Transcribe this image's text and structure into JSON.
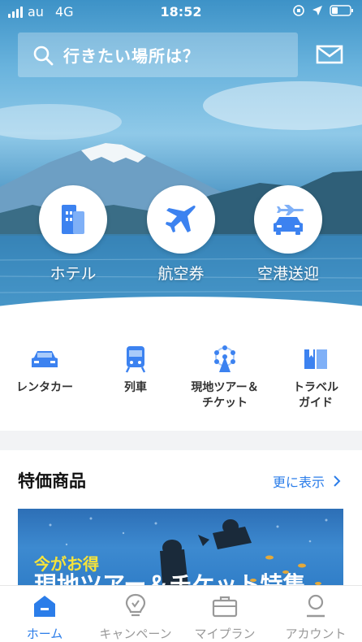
{
  "status_bar": {
    "carrier": "au",
    "network": "4G",
    "time": "18:52"
  },
  "search": {
    "placeholder": "行きたい場所は？"
  },
  "main_services": [
    {
      "label": "ホテル",
      "icon": "hotel-icon"
    },
    {
      "label": "航空券",
      "icon": "airplane-icon"
    },
    {
      "label": "空港送迎",
      "icon": "airport-transfer-icon"
    }
  ],
  "sub_services": [
    {
      "label": "レンタカー",
      "icon": "car-icon"
    },
    {
      "label": "列車",
      "icon": "train-icon"
    },
    {
      "label": "現地ツアー＆\nチケット",
      "line1": "現地ツアー＆",
      "line2": "チケット",
      "icon": "ferris-wheel-icon"
    },
    {
      "label": "トラベル\nガイド",
      "line1": "トラベル",
      "line2": "ガイド",
      "icon": "guidebook-icon"
    }
  ],
  "deals": {
    "title": "特価商品",
    "more_label": "更に表示",
    "banner_tag": "今がお得",
    "banner_headline": "現地ツアー＆チケット特集"
  },
  "tabs": [
    {
      "label": "ホーム",
      "icon": "home-icon",
      "active": true
    },
    {
      "label": "キャンペーン",
      "icon": "lightbulb-icon",
      "active": false
    },
    {
      "label": "マイプラン",
      "icon": "briefcase-icon",
      "active": false
    },
    {
      "label": "アカウント",
      "icon": "person-icon",
      "active": false
    }
  ],
  "colors": {
    "accent": "#2b7de9",
    "tab_inactive": "#999999",
    "banner_tag": "#f6e33a"
  }
}
